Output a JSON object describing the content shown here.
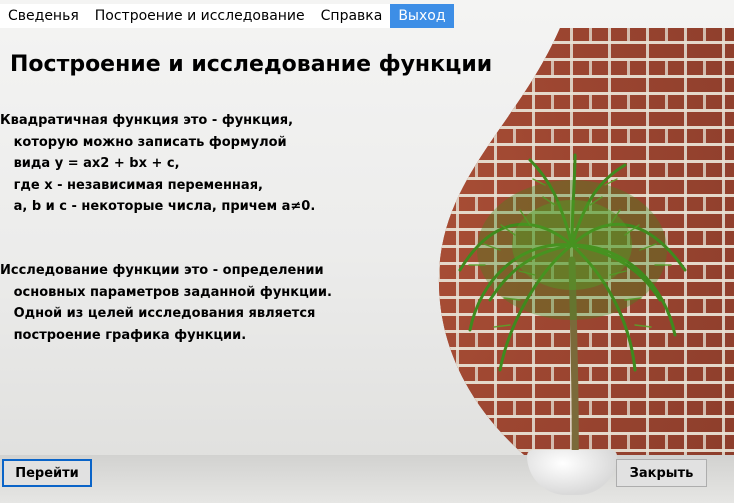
{
  "menu": {
    "items": [
      {
        "label": "Сведенья"
      },
      {
        "label": "Построение и исследование"
      },
      {
        "label": "Справка"
      },
      {
        "label": "Выход"
      }
    ]
  },
  "main": {
    "title": "Построение и исследование функции",
    "paragraph1": "Квадратичная функция это - функция,\n   которую можно записать формулой\n   вида y = ax2 + bx + c,\n   где x - независимая переменная,\n   a, b и c - некоторые числа, причем a≠0.",
    "paragraph2": "Исследование функции это - определении\n   основных параметров заданной функции.\n   Одной из целей исследования является\n   построение графика функции."
  },
  "buttons": {
    "go_label": "Перейти",
    "close_label": "Закрыть"
  },
  "colors": {
    "menu_active_bg": "#3d8ee6",
    "focus_border": "#0a64c8"
  }
}
